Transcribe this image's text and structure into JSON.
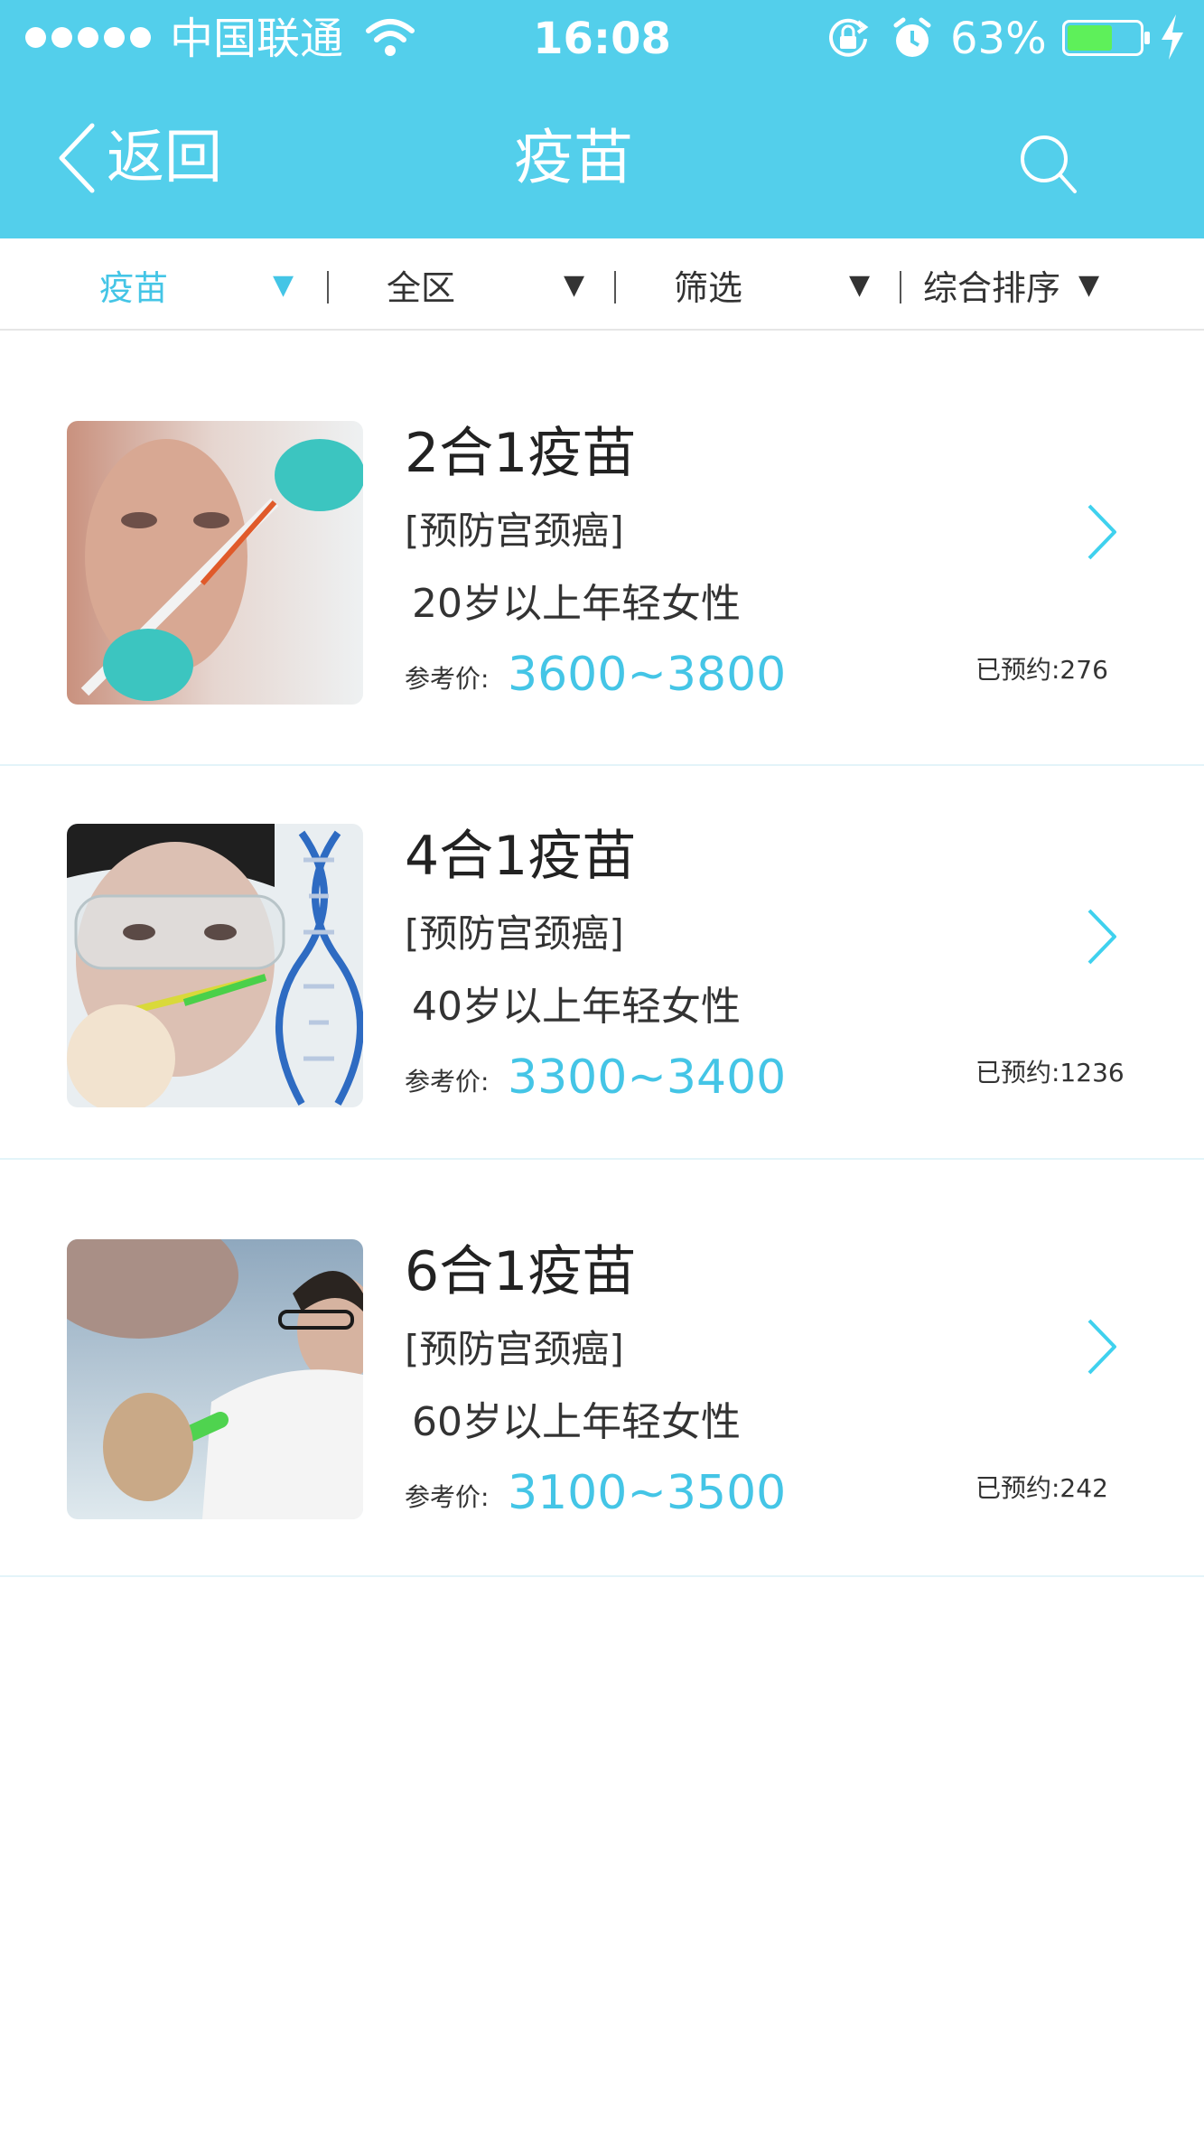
{
  "status_bar": {
    "carrier": "中国联通",
    "time": "16:08",
    "battery_percent": "63%",
    "battery_level": 0.63
  },
  "nav": {
    "back_label": "返回",
    "title": "疫苗"
  },
  "filters": [
    {
      "label": "疫苗",
      "active": true
    },
    {
      "label": "全区",
      "active": false
    },
    {
      "label": "筛选",
      "active": false
    },
    {
      "label": "综合排序",
      "active": false
    }
  ],
  "items": [
    {
      "title": "2合1疫苗",
      "tag": "[预防宫颈癌]",
      "audience": "20岁以上年轻女性",
      "price_label": "参考价:",
      "price": "3600~3800",
      "booked": "已预约:276"
    },
    {
      "title": "4合1疫苗",
      "tag": "[预防宫颈癌]",
      "audience": "40岁以上年轻女性",
      "price_label": "参考价:",
      "price": "3300~3400",
      "booked": "已预约:1236"
    },
    {
      "title": "6合1疫苗",
      "tag": "[预防宫颈癌]",
      "audience": "60岁以上年轻女性",
      "price_label": "参考价:",
      "price": "3100~3500",
      "booked": "已预约:242"
    }
  ],
  "colors": {
    "header": "#53cfeb",
    "accent": "#44c5e6",
    "battery_fill": "#5ef05a"
  }
}
